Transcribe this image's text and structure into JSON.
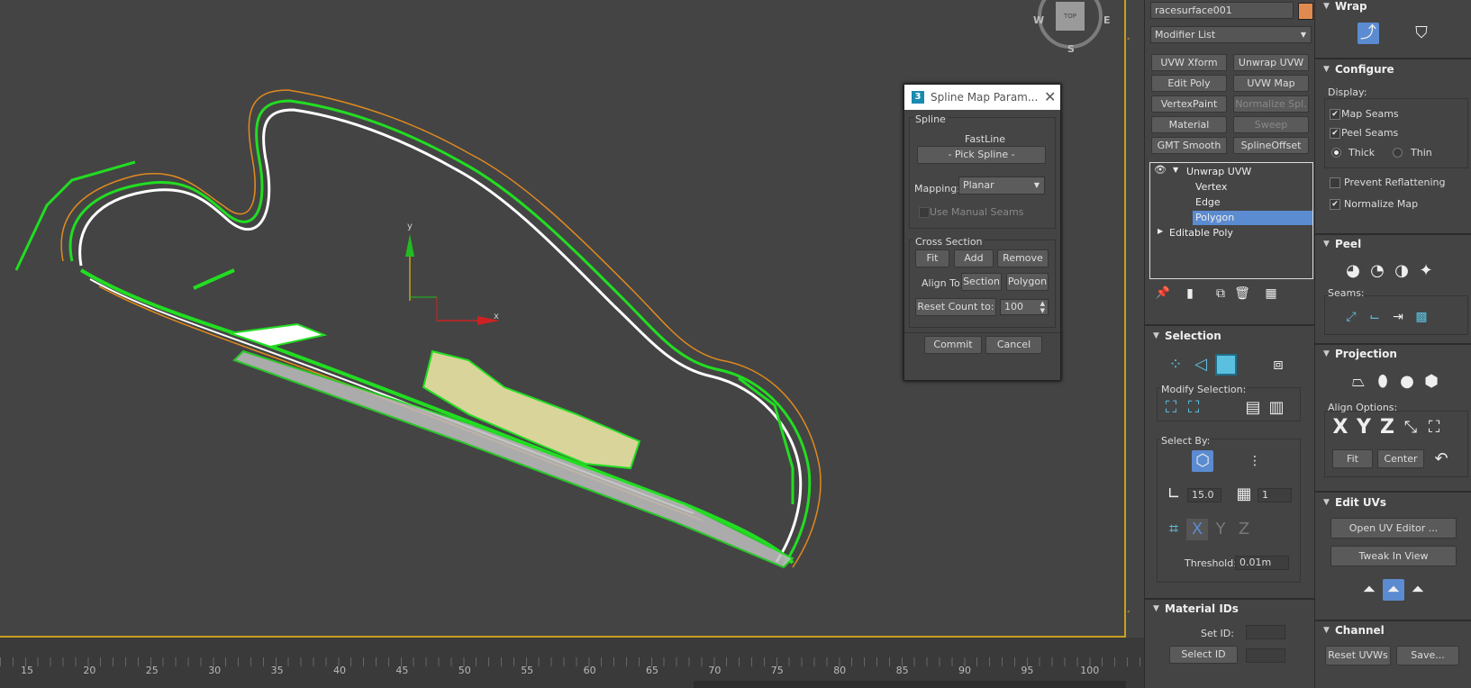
{
  "viewport": {
    "compass": {
      "top_label": "TOP",
      "w": "W",
      "e": "E",
      "s": "S"
    },
    "axis": {
      "y": "y",
      "x": "x"
    }
  },
  "timeline": {
    "ticks": [
      "15",
      "20",
      "25",
      "30",
      "35",
      "40",
      "45",
      "50",
      "55",
      "60",
      "65",
      "70",
      "75",
      "80",
      "85",
      "90",
      "95",
      "100"
    ]
  },
  "dialog": {
    "title": "Spline Map Param...",
    "spline_group": "Spline",
    "spline_name": "FastLine",
    "pick_spline": "- Pick Spline -",
    "mapping_label": "Mapping:",
    "mapping_value": "Planar",
    "use_manual_seams": "Use Manual Seams",
    "cross_section_group": "Cross Section",
    "fit": "Fit",
    "add": "Add",
    "remove": "Remove",
    "align_to": "Align To:",
    "section": "Section",
    "polygon": "Polygon",
    "reset_count": "Reset Count to:",
    "reset_count_value": "100",
    "commit": "Commit",
    "cancel": "Cancel"
  },
  "modifier_panel": {
    "object_name": "racesurface001",
    "object_color": "#e08a50",
    "modifier_list": "Modifier List",
    "buttons": [
      "UVW Xform",
      "Unwrap UVW",
      "Edit Poly",
      "UVW Map",
      "VertexPaint",
      "Normalize Spl.",
      "Material",
      "Sweep",
      "GMT Smooth",
      "SplineOffset"
    ],
    "stack": {
      "unwrap": "Unwrap UVW",
      "vertex": "Vertex",
      "edge": "Edge",
      "polygon": "Polygon",
      "editable_poly": "Editable Poly"
    },
    "selection": {
      "title": "Selection",
      "modify_selection": "Modify Selection:",
      "select_by": "Select By:",
      "angle_value": "15.0",
      "count_value": "1",
      "threshold_label": "Threshold:",
      "threshold_value": "0.01m"
    },
    "material_ids": {
      "title": "Material IDs",
      "set_id": "Set ID:",
      "select_id": "Select ID"
    }
  },
  "right_panel": {
    "wrap": {
      "title": "Wrap"
    },
    "configure": {
      "title": "Configure",
      "display": "Display:",
      "map_seams": "Map Seams",
      "peel_seams": "Peel Seams",
      "thick": "Thick",
      "thin": "Thin",
      "prevent_reflattening": "Prevent Reflattening",
      "normalize_map": "Normalize Map"
    },
    "peel": {
      "title": "Peel",
      "seams": "Seams:"
    },
    "projection": {
      "title": "Projection",
      "align_options": "Align Options:",
      "x": "X",
      "y": "Y",
      "z": "Z",
      "fit": "Fit",
      "center": "Center"
    },
    "edit_uvs": {
      "title": "Edit UVs",
      "open_uv_editor": "Open UV Editor ...",
      "tweak_in_view": "Tweak In View"
    },
    "channel": {
      "title": "Channel",
      "reset_uvws": "Reset UVWs",
      "save": "Save..."
    }
  },
  "colors": {
    "accent": "#5b8bd0",
    "track_green": "#22dd22",
    "track_orange": "#e08a1e",
    "viewport_border": "#c8a020"
  }
}
